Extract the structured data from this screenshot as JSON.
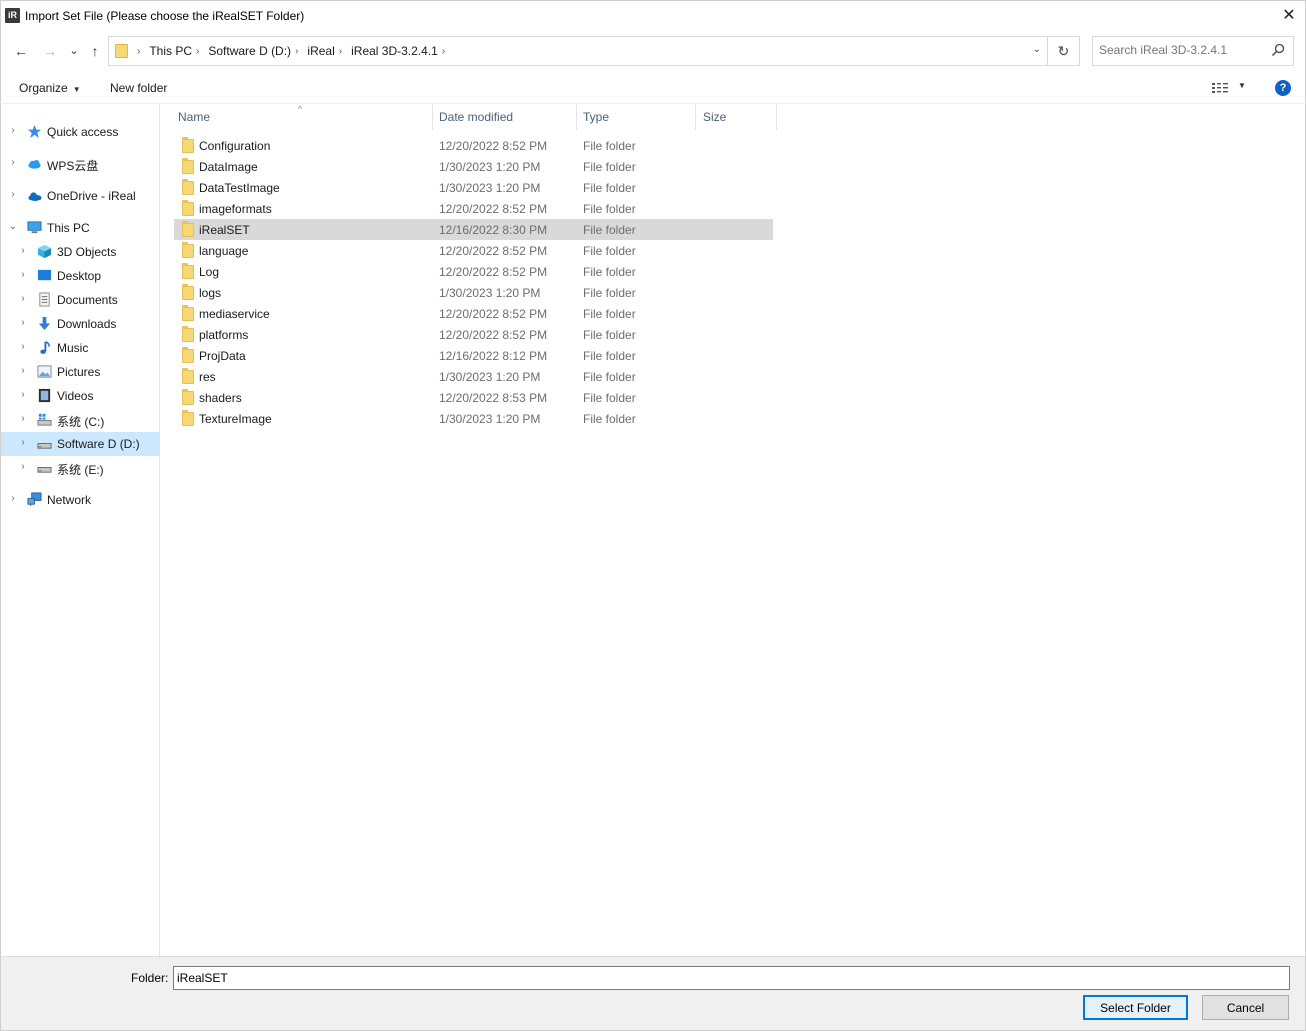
{
  "window": {
    "title": "Import Set File (Please choose the iRealSET Folder)",
    "app_icon_text": "iR",
    "close_glyph": "✕"
  },
  "nav": {
    "back_glyph": "←",
    "forward_glyph": "→",
    "recent_glyph": "⌄",
    "up_glyph": "↑"
  },
  "address": {
    "crumbs": [
      "This PC",
      "Software D (D:)",
      "iReal",
      "iReal 3D-3.2.4.1"
    ],
    "separator": "›",
    "dropdown_glyph": "⌄",
    "refresh_glyph": "↻"
  },
  "search": {
    "placeholder": "Search iReal 3D-3.2.4.1"
  },
  "toolbar": {
    "organize_label": "Organize",
    "organize_arrow": "▼",
    "new_folder_label": "New folder",
    "view_arrow": "▼",
    "help_glyph": "?"
  },
  "sidebar": {
    "items": [
      {
        "label": "Quick access",
        "icon": "star-icon",
        "chevron": "›",
        "indent": 0
      },
      {
        "label": "WPS云盘",
        "icon": "cloud-icon",
        "chevron": "›",
        "indent": 0
      },
      {
        "label": "OneDrive - iReal",
        "icon": "onedrive-icon",
        "chevron": "›",
        "indent": 0
      },
      {
        "label": "This PC",
        "icon": "computer-icon",
        "chevron": "⌄",
        "indent": 0
      },
      {
        "label": "3D Objects",
        "icon": "cube-icon",
        "chevron": "›",
        "indent": 1
      },
      {
        "label": "Desktop",
        "icon": "desktop-icon",
        "chevron": "›",
        "indent": 1
      },
      {
        "label": "Documents",
        "icon": "document-icon",
        "chevron": "›",
        "indent": 1
      },
      {
        "label": "Downloads",
        "icon": "download-icon",
        "chevron": "›",
        "indent": 1
      },
      {
        "label": "Music",
        "icon": "music-icon",
        "chevron": "›",
        "indent": 1
      },
      {
        "label": "Pictures",
        "icon": "pictures-icon",
        "chevron": "›",
        "indent": 1
      },
      {
        "label": "Videos",
        "icon": "video-icon",
        "chevron": "›",
        "indent": 1
      },
      {
        "label": "系统 (C:)",
        "icon": "windows-drive-icon",
        "chevron": "›",
        "indent": 1
      },
      {
        "label": "Software D (D:)",
        "icon": "drive-icon",
        "chevron": "›",
        "indent": 1
      },
      {
        "label": "系统 (E:)",
        "icon": "drive-icon",
        "chevron": "›",
        "indent": 1
      },
      {
        "label": "Network",
        "icon": "network-icon",
        "chevron": "›",
        "indent": 0
      }
    ]
  },
  "columns": {
    "name": "Name",
    "date": "Date modified",
    "type": "Type",
    "size": "Size",
    "sort_glyph": "^"
  },
  "files": [
    {
      "name": "Configuration",
      "date": "12/20/2022 8:52 PM",
      "type": "File folder"
    },
    {
      "name": "DataImage",
      "date": "1/30/2023 1:20 PM",
      "type": "File folder"
    },
    {
      "name": "DataTestImage",
      "date": "1/30/2023 1:20 PM",
      "type": "File folder"
    },
    {
      "name": "imageformats",
      "date": "12/20/2022 8:52 PM",
      "type": "File folder"
    },
    {
      "name": "iRealSET",
      "date": "12/16/2022 8:30 PM",
      "type": "File folder"
    },
    {
      "name": "language",
      "date": "12/20/2022 8:52 PM",
      "type": "File folder"
    },
    {
      "name": "Log",
      "date": "12/20/2022 8:52 PM",
      "type": "File folder"
    },
    {
      "name": "logs",
      "date": "1/30/2023 1:20 PM",
      "type": "File folder"
    },
    {
      "name": "mediaservice",
      "date": "12/20/2022 8:52 PM",
      "type": "File folder"
    },
    {
      "name": "platforms",
      "date": "12/20/2022 8:52 PM",
      "type": "File folder"
    },
    {
      "name": "ProjData",
      "date": "12/16/2022 8:12 PM",
      "type": "File folder"
    },
    {
      "name": "res",
      "date": "1/30/2023 1:20 PM",
      "type": "File folder"
    },
    {
      "name": "shaders",
      "date": "12/20/2022 8:53 PM",
      "type": "File folder"
    },
    {
      "name": "TextureImage",
      "date": "1/30/2023 1:20 PM",
      "type": "File folder"
    }
  ],
  "selected_file": "iRealSET",
  "selected_sidebar": "Software D (D:)",
  "footer": {
    "folder_label": "Folder:",
    "folder_value": "iRealSET",
    "select_button": "Select Folder",
    "cancel_button": "Cancel"
  },
  "colors": {
    "accent": "#0078d7",
    "sidebar_selected": "#cce8ff",
    "row_selected": "#d9d9d9",
    "folder": "#f8d775"
  }
}
